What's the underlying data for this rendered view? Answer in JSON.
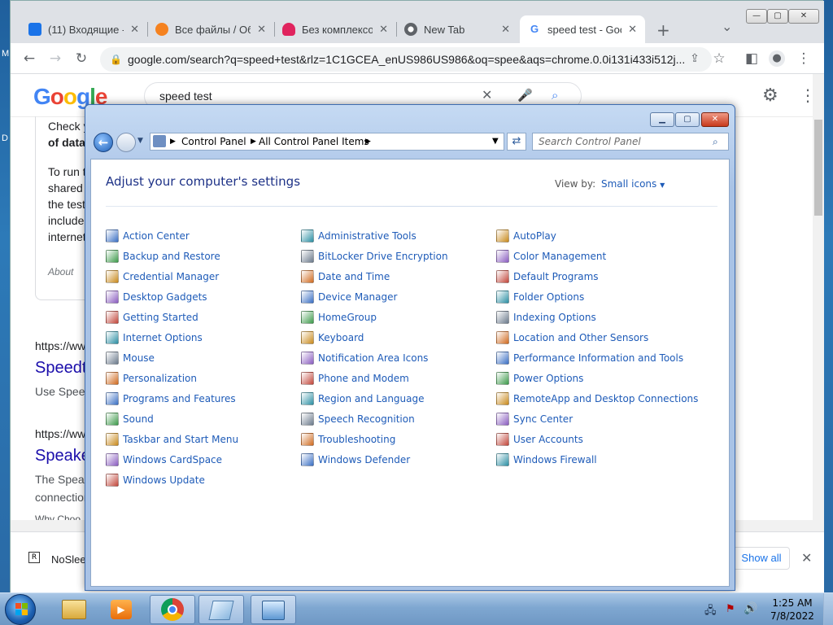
{
  "desktop": {
    "left_chars": [
      "M",
      "D"
    ]
  },
  "chrome": {
    "tabs": [
      {
        "label": "(11) Входящие - ",
        "favicon": "mail-icon",
        "color": "#1a73e8"
      },
      {
        "label": "Все файлы / Обл",
        "favicon": "cloud-icon",
        "color": "#f58220"
      },
      {
        "label": "Без комплексов",
        "favicon": "lips-icon",
        "color": "#e0245e"
      },
      {
        "label": "New Tab",
        "favicon": "chrome-icon",
        "color": "#5f6368"
      },
      {
        "label": "speed test - Goo",
        "favicon": "google-icon",
        "color": "#4285f4"
      }
    ],
    "new_tab_symbol": "+",
    "tab_search_symbol": "⌄",
    "window_controls": [
      "—",
      "▢",
      "✕"
    ],
    "omnibox_url": "google.com/search?q=speed+test&rlz=1C1GCEA_enUS986US986&oq=spee&aqs=chrome.0.0i131i433i512j..."
  },
  "google": {
    "logo": "Google",
    "query": "speed test",
    "snippet": {
      "line1": "Check y",
      "line2": "of data",
      "para": [
        "To run t",
        "shared",
        "the test",
        "include",
        "internet"
      ],
      "about": "About"
    },
    "results": [
      {
        "url": "https://www",
        "title": "Speedt",
        "desc": "Use Speed"
      },
      {
        "url": "https://www",
        "title": "Speake",
        "desc": "The Spea",
        "desc2": "connection",
        "desc3": "Why Choo"
      }
    ]
  },
  "download_bar": {
    "file": "NoSlee",
    "show_all": "Show all",
    "close": "✕"
  },
  "control_panel": {
    "breadcrumbs": [
      "Control Panel",
      "All Control Panel Items"
    ],
    "search_placeholder": "Search Control Panel",
    "title": "Adjust your computer's settings",
    "view_by_label": "View by:",
    "view_by_value": "Small icons",
    "columns": [
      [
        "Action Center",
        "Backup and Restore",
        "Credential Manager",
        "Desktop Gadgets",
        "Getting Started",
        "Internet Options",
        "Mouse",
        "Personalization",
        "Programs and Features",
        "Sound",
        "Taskbar and Start Menu",
        "Windows CardSpace",
        "Windows Update"
      ],
      [
        "Administrative Tools",
        "BitLocker Drive Encryption",
        "Date and Time",
        "Device Manager",
        "HomeGroup",
        "Keyboard",
        "Notification Area Icons",
        "Phone and Modem",
        "Region and Language",
        "Speech Recognition",
        "Troubleshooting",
        "Windows Defender"
      ],
      [
        "AutoPlay",
        "Color Management",
        "Default Programs",
        "Folder Options",
        "Indexing Options",
        "Location and Other Sensors",
        "Performance Information and Tools",
        "Power Options",
        "RemoteApp and Desktop Connections",
        "Sync Center",
        "User Accounts",
        "Windows Firewall"
      ]
    ]
  },
  "taskbar": {
    "time": "1:25 AM",
    "date": "7/8/2022",
    "buttons": [
      "start-orb",
      "explorer",
      "media-player",
      "chrome",
      "notepad",
      "control-panel"
    ]
  }
}
